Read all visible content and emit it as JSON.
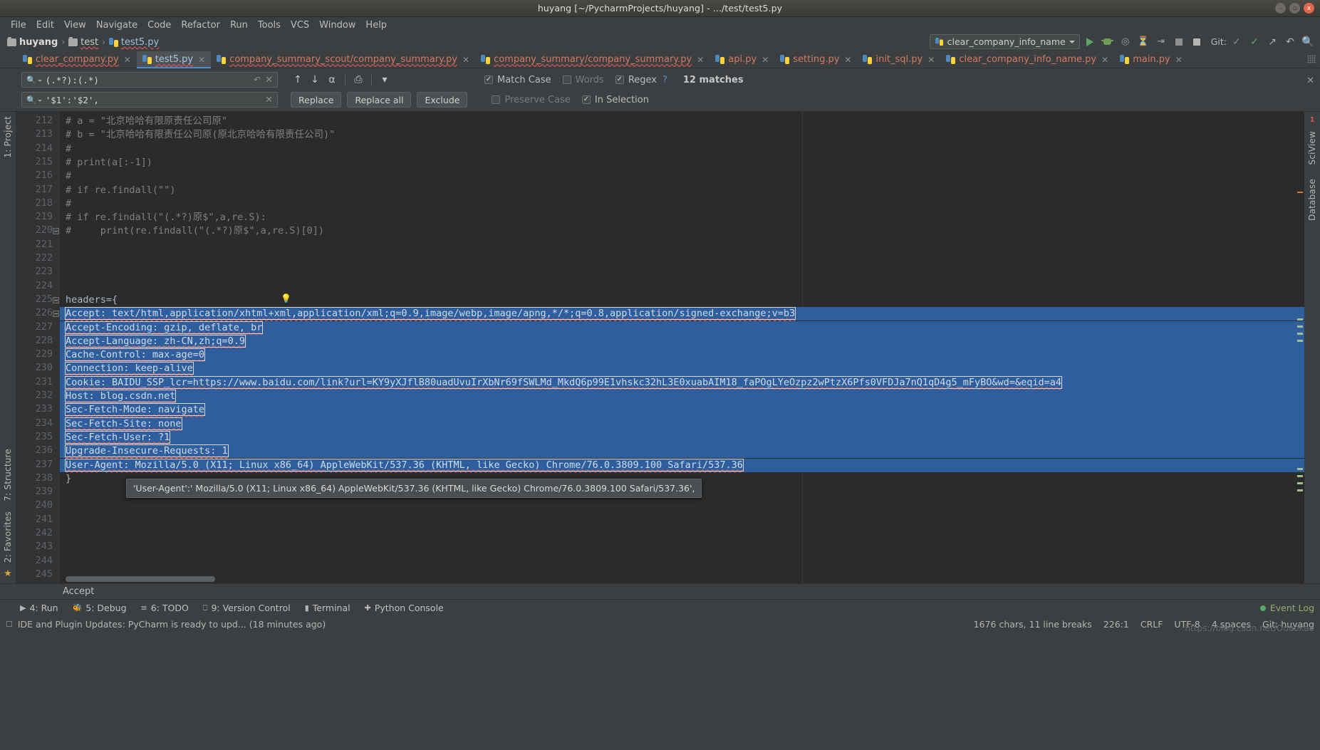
{
  "window": {
    "title": "huyang [~/PycharmProjects/huyang] - .../test/test5.py",
    "minimize": "–",
    "maximize": "▫",
    "close": "x"
  },
  "menu": [
    "File",
    "Edit",
    "View",
    "Navigate",
    "Code",
    "Refactor",
    "Run",
    "Tools",
    "VCS",
    "Window",
    "Help"
  ],
  "breadcrumb": {
    "items": [
      {
        "label": "huyang",
        "icon": "folder-icon",
        "bold": true,
        "misspelled": false
      },
      {
        "label": "test",
        "icon": "folder-icon",
        "bold": false,
        "misspelled": true
      },
      {
        "label": "test5.py",
        "icon": "python-file-icon",
        "bold": false,
        "misspelled": true
      }
    ],
    "separator": "›"
  },
  "run_config": {
    "name": "clear_company_info_name",
    "icons": [
      "run-icon",
      "debug-icon",
      "coverage-icon",
      "profile-icon",
      "attach-icon",
      "stop-icon"
    ],
    "git_label": "Git:",
    "git_icons": [
      "update-project-icon",
      "commit-icon",
      "push-icon",
      "rollback-icon",
      "search-everywhere-icon"
    ]
  },
  "tabs": [
    {
      "label": "clear_company.py",
      "active": false,
      "wavy": true
    },
    {
      "label": "test5.py",
      "active": true,
      "wavy": true
    },
    {
      "label": "company_summary_scout/company_summary.py",
      "active": false,
      "wavy": true
    },
    {
      "label": "company_summary/company_summary.py",
      "active": false,
      "wavy": true
    },
    {
      "label": "api.py",
      "active": false,
      "wavy": false
    },
    {
      "label": "setting.py",
      "active": false,
      "wavy": false
    },
    {
      "label": "init_sql.py",
      "active": false,
      "wavy": false
    },
    {
      "label": "clear_company_info_name.py",
      "active": false,
      "wavy": false
    },
    {
      "label": "main.py",
      "active": false,
      "wavy": false
    }
  ],
  "find": {
    "search_value": "(.*?):(.*)",
    "replace_value": "'$1':'$2',",
    "buttons": {
      "replace": "Replace",
      "replace_all": "Replace all",
      "exclude": "Exclude"
    },
    "options": [
      {
        "label": "Match Case",
        "checked": true
      },
      {
        "label": "Words",
        "checked": false
      },
      {
        "label": "Regex",
        "checked": true
      },
      {
        "label": "Preserve Case",
        "checked": false
      },
      {
        "label": "In Selection",
        "checked": true
      }
    ],
    "help": "?",
    "matches": "12 matches",
    "close": "✕",
    "icons": [
      "prev-match-icon",
      "next-match-icon",
      "select-all-occurrences-icon",
      "open-in-find-window-icon",
      "filter-icon"
    ]
  },
  "editor": {
    "first_line": 212,
    "lines": [
      {
        "n": 212,
        "text": "# a = \"北京哈哈有限原责任公司原\"",
        "kind": "comment"
      },
      {
        "n": 213,
        "text": "# b = \"北京哈哈有限责任公司原(原北京哈哈有限责任公司)\"",
        "kind": "comment"
      },
      {
        "n": 214,
        "text": "#",
        "kind": "comment"
      },
      {
        "n": 215,
        "text": "# print(a[:-1])",
        "kind": "comment"
      },
      {
        "n": 216,
        "text": "#",
        "kind": "comment"
      },
      {
        "n": 217,
        "text": "# if re.findall(\"\")",
        "kind": "comment"
      },
      {
        "n": 218,
        "text": "#",
        "kind": "comment"
      },
      {
        "n": 219,
        "text": "# if re.findall(\"(.*?)原$\",a,re.S):",
        "kind": "comment"
      },
      {
        "n": 220,
        "text": "#     print(re.findall(\"(.*?)原$\",a,re.S)[0])",
        "kind": "comment",
        "fold": true
      },
      {
        "n": 221,
        "text": "",
        "kind": "blank"
      },
      {
        "n": 222,
        "text": "",
        "kind": "blank"
      },
      {
        "n": 223,
        "text": "",
        "kind": "blank"
      },
      {
        "n": 224,
        "text": "",
        "kind": "blank"
      },
      {
        "n": 225,
        "text": "headers={",
        "kind": "code",
        "fold": true
      },
      {
        "n": 226,
        "text": "Accept: text/html,application/xhtml+xml,application/xml;q=0.9,image/webp,image/apng,*/*;q=0.8,application/signed-exchange;v=b3",
        "kind": "selected",
        "framed": true,
        "fold": true
      },
      {
        "n": 227,
        "text": "Accept-Encoding: gzip, deflate, br",
        "kind": "selected",
        "framed": true
      },
      {
        "n": 228,
        "text": "Accept-Language: zh-CN,zh;q=0.9",
        "kind": "selected",
        "framed": true
      },
      {
        "n": 229,
        "text": "Cache-Control: max-age=0",
        "kind": "selected",
        "framed": true
      },
      {
        "n": 230,
        "text": "Connection: keep-alive",
        "kind": "selected",
        "framed": true
      },
      {
        "n": 231,
        "text": "Cookie: BAIDU_SSP_lcr=https://www.baidu.com/link?url=KY9yXJflB80uadUvuIrXbNr69fSWLMd_MkdQ6p99E1vhskc32hL3E0xuabAIM18_faPOgLYeOzpz2wPtzX6Pfs0VFDJa7nQ1qD4g5_mFyBO&wd=&eqid=a4",
        "kind": "selected",
        "framed": true
      },
      {
        "n": 232,
        "text": "Host: blog.csdn.net",
        "kind": "selected",
        "framed": true
      },
      {
        "n": 233,
        "text": "Sec-Fetch-Mode: navigate",
        "kind": "selected",
        "framed": true
      },
      {
        "n": 234,
        "text": "Sec-Fetch-Site: none",
        "kind": "selected",
        "framed": true
      },
      {
        "n": 235,
        "text": "Sec-Fetch-User: ?1",
        "kind": "selected",
        "framed": true
      },
      {
        "n": 236,
        "text": "Upgrade-Insecure-Requests: 1",
        "kind": "selected",
        "framed": true
      },
      {
        "n": 237,
        "text": "User-Agent: Mozilla/5.0 (X11; Linux x86_64) AppleWebKit/537.36 (KHTML, like Gecko) Chrome/76.0.3809.100 Safari/537.36",
        "kind": "selected",
        "framed": true
      },
      {
        "n": 238,
        "text": "}",
        "kind": "code"
      },
      {
        "n": 239,
        "text": "",
        "kind": "blank"
      },
      {
        "n": 240,
        "text": "",
        "kind": "blank"
      },
      {
        "n": 241,
        "text": "",
        "kind": "blank"
      },
      {
        "n": 242,
        "text": "",
        "kind": "blank"
      },
      {
        "n": 243,
        "text": "",
        "kind": "blank"
      },
      {
        "n": 244,
        "text": "",
        "kind": "blank"
      },
      {
        "n": 245,
        "text": "",
        "kind": "blank"
      }
    ],
    "tooltip": "'User-Agent':' Mozilla/5.0 (X11; Linux x86_64) AppleWebKit/537.36 (KHTML, like Gecko) Chrome/76.0.3809.100 Safari/537.36',",
    "bottom_breadcrumb": "Accept",
    "error_count": "1"
  },
  "left_strip": {
    "top": "1: Project",
    "mid": "7: Structure",
    "bottom": "2: Favorites"
  },
  "right_strip": {
    "label": "SciView",
    "label2": "Database"
  },
  "tool_windows": [
    {
      "label": "4: Run",
      "icon": "run-icon"
    },
    {
      "label": "5: Debug",
      "icon": "debug-icon"
    },
    {
      "label": "6: TODO",
      "icon": "todo-icon"
    },
    {
      "label": "9: Version Control",
      "icon": "vcs-icon"
    },
    {
      "label": "Terminal",
      "icon": "terminal-icon"
    },
    {
      "label": "Python Console",
      "icon": "python-console-icon"
    }
  ],
  "event_log": "Event Log",
  "status": {
    "notification": "IDE and Plugin Updates: PyCharm is ready to upd... (18 minutes ago)",
    "chars": "1676 chars, 11 line breaks",
    "caret": "226:1",
    "line_sep": "CRLF",
    "encoding": "UTF-8",
    "indent": "4 spaces",
    "git_branch": "Git: huyang",
    "watermark": "https://blog.csdn.net/Odaokao"
  },
  "colors": {
    "chrome": "#3c3f41",
    "editor_bg": "#2b2b2b",
    "gutter_bg": "#313335",
    "selection": "#2f5e9e",
    "tab_text": "#d4795d",
    "accent_blue": "#4a88c7"
  }
}
